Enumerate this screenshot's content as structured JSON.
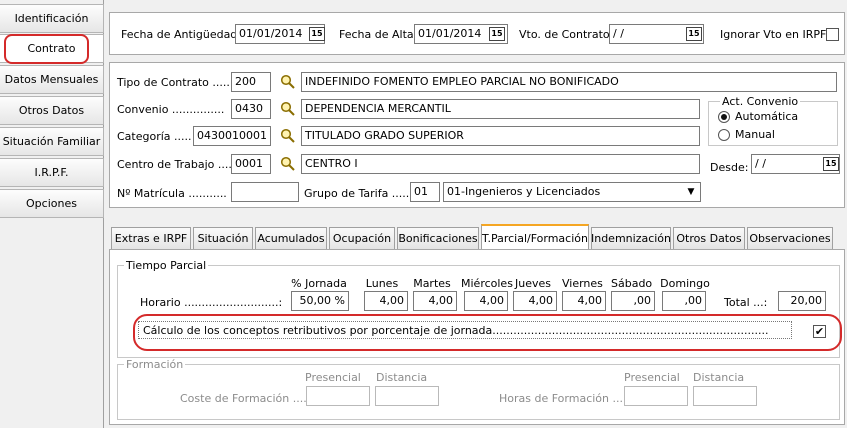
{
  "nav": {
    "items": [
      {
        "label": "Identificación"
      },
      {
        "label": "Contrato"
      },
      {
        "label": "Datos Mensuales"
      },
      {
        "label": "Otros Datos"
      },
      {
        "label": "Situación Familiar"
      },
      {
        "label": "I.R.P.F."
      },
      {
        "label": "Opciones"
      }
    ],
    "active_index": 1
  },
  "dates": {
    "antiguedad_label": "Fecha de Antigüedad:",
    "antiguedad_value": "01/01/2014",
    "alta_label": "Fecha de Alta:",
    "alta_value": "01/01/2014",
    "vto_label": "Vto. de Contrato:",
    "vto_value": " / /",
    "ignorar_label": "Ignorar Vto en IRPF",
    "ignorar_checked": false,
    "calendar_glyph": "15"
  },
  "contract": {
    "tipo_label": "Tipo de Contrato ......",
    "tipo_code": "200",
    "tipo_desc": "INDEFINIDO FOMENTO EMPLEO PARCIAL NO BONIFICADO",
    "convenio_label": "Convenio ...............",
    "convenio_code": "0430",
    "convenio_desc": "DEPENDENCIA MERCANTIL",
    "categoria_label": "Categoría .....",
    "categoria_code": "0430010001",
    "categoria_desc": "TITULADO GRADO SUPERIOR",
    "centro_label": "Centro de Trabajo ....",
    "centro_code": "0001",
    "centro_desc": "CENTRO I",
    "matricula_label": "Nº Matrícula ...........",
    "matricula_value": "",
    "grupo_label": "Grupo de Tarifa .....",
    "grupo_code": "01",
    "grupo_desc": "01-Ingenieros y Licenciados",
    "act_convenio_title": "Act. Convenio",
    "radio_auto": "Automática",
    "radio_manual": "Manual",
    "radio_selected": "Automática",
    "desde_label": "Desde:",
    "desde_value": " / /"
  },
  "tabs": [
    {
      "label": "Extras e IRPF"
    },
    {
      "label": "Situación"
    },
    {
      "label": "Acumulados"
    },
    {
      "label": "Ocupación"
    },
    {
      "label": "Bonificaciones"
    },
    {
      "label": "T.Parcial/Formación"
    },
    {
      "label": "Indemnización"
    },
    {
      "label": "Otros Datos"
    },
    {
      "label": "Observaciones"
    }
  ],
  "active_tab": "T.Parcial/Formación",
  "tiempo_parcial": {
    "title": "Tiempo Parcial",
    "horario_label": "Horario ...........................:",
    "headers": [
      "% Jornada",
      "Lunes",
      "Martes",
      "Miércoles",
      "Jueves",
      "Viernes",
      "Sábado",
      "Domingo"
    ],
    "values": [
      "50,00 %",
      "4,00",
      "4,00",
      "4,00",
      "4,00",
      "4,00",
      ",00",
      ",00"
    ],
    "total_label": "Total ...:",
    "total_value": "20,00",
    "calculo_label": "Cálculo de los conceptos retributivos por porcentaje de jornada...............................................................................",
    "calculo_checked": true,
    "check_glyph": "✔"
  },
  "formacion": {
    "title": "Formación",
    "presencial_label": "Presencial",
    "distancia_label": "Distancia",
    "coste_label": "Coste de Formación ....:",
    "horas_label": "Horas de Formación ....:",
    "coste_presencial": "",
    "coste_distancia": "",
    "horas_presencial": "",
    "horas_distancia": ""
  },
  "colors": {
    "highlight_red": "#d42a2a",
    "active_tab_accent": "#f5a623"
  }
}
